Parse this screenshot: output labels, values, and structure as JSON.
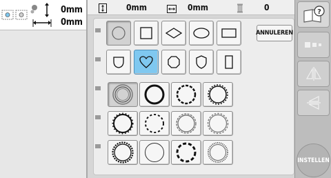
{
  "preview": {
    "height_value": "0mm",
    "width_value": "0mm"
  },
  "info": {
    "height": "0mm",
    "width": "0mm",
    "colors": "0"
  },
  "buttons": {
    "cancel": "ANNULEREN",
    "set": "INSTELLEN"
  },
  "shapes": {
    "row1": [
      "circle",
      "square",
      "diamond",
      "oval",
      "rectangle"
    ],
    "row2": [
      "shield-u",
      "heart",
      "octagon",
      "shield",
      "tall-rectangle"
    ],
    "selected_shape": "circle",
    "active_shape": "heart"
  },
  "frames": {
    "rows": 3,
    "cols": 4,
    "selected_frame": 0
  },
  "colors": {
    "active": "#7fc8f0",
    "panel": "#d6d6d6"
  }
}
